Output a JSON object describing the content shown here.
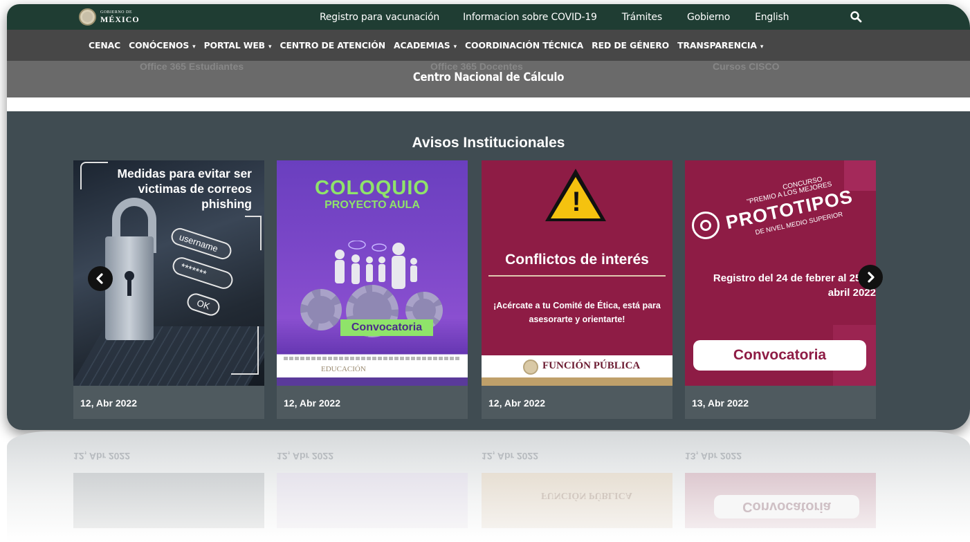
{
  "gov": {
    "logo_line1": "GOBIERNO DE",
    "logo_line2": "MÉXICO",
    "links": [
      "Registro para vacunación",
      "Informacion sobre COVID-19",
      "Trámites",
      "Gobierno",
      "English"
    ],
    "search_icon": "search-icon"
  },
  "nav": {
    "items": [
      {
        "label": "CENAC",
        "dropdown": false
      },
      {
        "label": "CONÓCENOS",
        "dropdown": true
      },
      {
        "label": "PORTAL WEB",
        "dropdown": true
      },
      {
        "label": "CENTRO DE ATENCIÓN",
        "dropdown": false
      },
      {
        "label": "ACADEMIAS",
        "dropdown": true
      },
      {
        "label": "COORDINACIÓN TÉCNICA",
        "dropdown": false
      },
      {
        "label": "RED DE GÉNERO",
        "dropdown": false
      },
      {
        "label": "TRANSPARENCIA",
        "dropdown": true
      }
    ],
    "caret": "▾"
  },
  "header": {
    "ghost_links": [
      "Office 365 Estudiantes",
      "Office 365 Docentes",
      "Cursos CISCO"
    ],
    "title": "Centro Nacional de Cálculo"
  },
  "avisos": {
    "title": "Avisos Institucionales",
    "cards": [
      {
        "date": "12, Abr 2022",
        "poster": {
          "headline": "Medidas para evitar ser victimas de correos phishing",
          "field_user": "username",
          "field_pass": "*******",
          "field_ok": "OK"
        }
      },
      {
        "date": "12, Abr 2022",
        "poster": {
          "title": "COLOQUIO",
          "subtitle": "PROYECTO AULA",
          "button": "Convocatoria",
          "footer_logo": "EDUCACIÓN"
        }
      },
      {
        "date": "12, Abr 2022",
        "poster": {
          "title": "Conflictos de interés",
          "text": "¡Acércate a tu Comité de Ética, está para asesorarte y orientarte!",
          "footer_logo": "FUNCIÓN PÚBLICA"
        }
      },
      {
        "date": "13, Abr 2022",
        "poster": {
          "line1": "CONCURSO",
          "line2": "\"PREMIO A LOS MEJORES",
          "line3": "PROTOTIPOS",
          "line4": "DE NIVEL MEDIO SUPERIOR",
          "registro": "Registro del 24 de febrer al 25 de abril 2022",
          "button": "Convocatoria"
        }
      }
    ]
  },
  "colors": {
    "gov_bar": "#1f3d33",
    "nav_bar": "#474747",
    "section_bg": "#404c52",
    "accent_maroon": "#8e1c45"
  }
}
